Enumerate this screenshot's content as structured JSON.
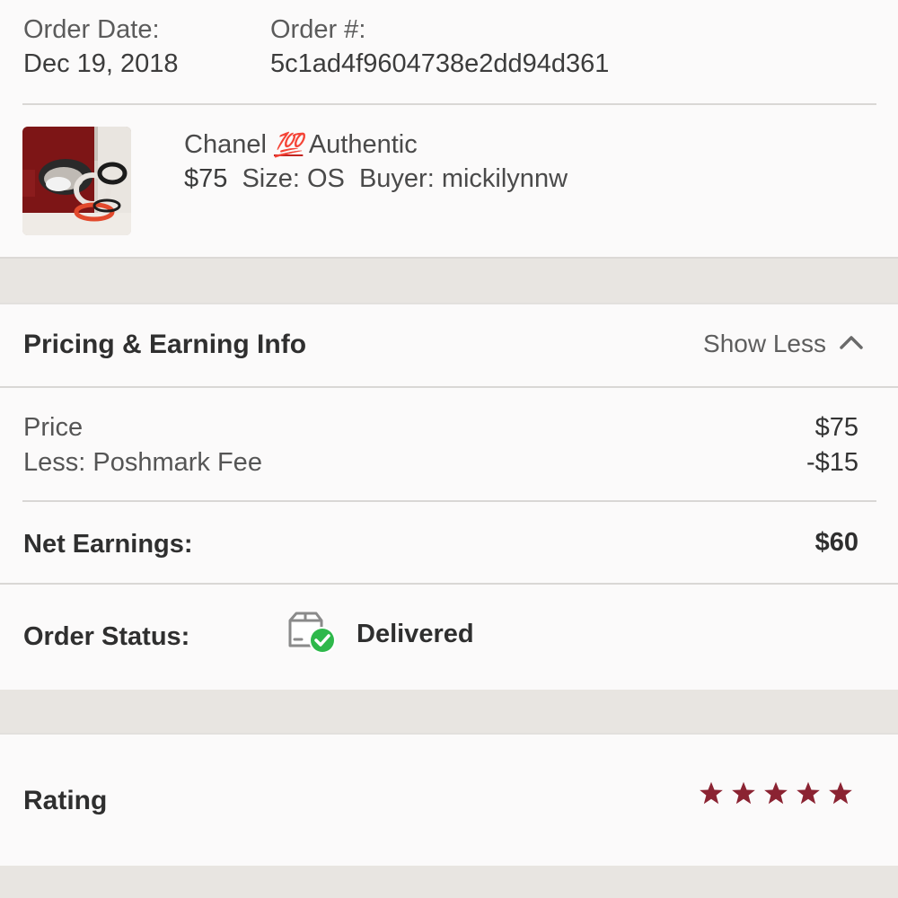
{
  "order": {
    "date_label": "Order Date:",
    "date_value": "Dec 19, 2018",
    "number_label": "Order #:",
    "number_value": "5c1ad4f9604738e2dd94d361"
  },
  "listing": {
    "title_before": "Chanel",
    "title_emoji": "💯",
    "title_after": "Authentic",
    "price": "$75",
    "size": "Size: OS",
    "buyer": "Buyer: mickilynnw"
  },
  "pricing": {
    "title": "Pricing & Earning Info",
    "toggle_label": "Show Less",
    "toggle_icon": "chevron-up-icon",
    "rows": [
      {
        "label": "Price",
        "value": "$75"
      },
      {
        "label": "Less: Poshmark Fee",
        "value": "-$15"
      }
    ],
    "net_label": "Net Earnings:",
    "net_value": "$60"
  },
  "status": {
    "label": "Order Status:",
    "icon": "delivered-box-icon",
    "value": "Delivered"
  },
  "rating": {
    "label": "Rating",
    "stars": 5,
    "star_color": "#8b2332"
  },
  "colors": {
    "accent": "#8b2332",
    "delivered_green": "#2eb84b",
    "divider": "#d9d7d5",
    "background": "#e9e6e2"
  }
}
